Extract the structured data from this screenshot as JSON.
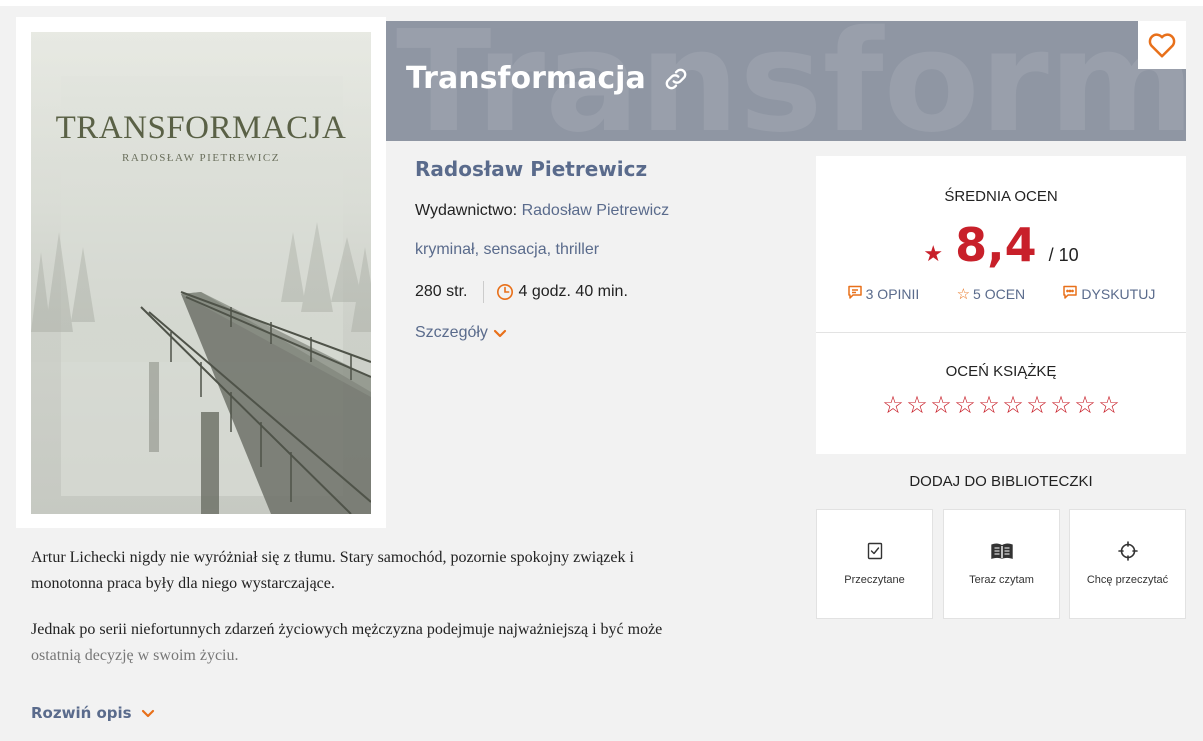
{
  "book": {
    "cover_title": "TRANSFORMACJA",
    "cover_author": "RADOSŁAW PIETREWICZ",
    "watermark": "Transforma",
    "title": "Transformacja",
    "author": "Radosław Pietrewicz",
    "publisher_label": "Wydawnictwo:",
    "publisher": "Radosław Pietrewicz",
    "genres": "kryminał, sensacja, thriller",
    "pages": "280 str.",
    "reading_time": "4 godz. 40 min.",
    "details_link": "Szczegóły"
  },
  "rating": {
    "avg_label": "ŚREDNIA OCEN",
    "avg_value": "8,4",
    "avg_max": "/ 10",
    "opinions": "3 OPINII",
    "ratings": "5 OCEN",
    "discuss": "DYSKUTUJ",
    "rate_label": "OCEŃ KSIĄŻKĘ",
    "stars_total": 10,
    "star_glyph": "☆"
  },
  "library": {
    "label": "DODAJ DO BIBLIOTECZKI",
    "buttons": {
      "read": "Przeczytane",
      "reading": "Teraz czytam",
      "want": "Chcę przeczytać"
    }
  },
  "description": {
    "p1_line1": "Artur Lichecki nigdy nie wyróżniał się z tłumu. Stary samochód, pozornie spokojny związek i",
    "p1_line2": "monotonna praca były dla niego wystarczające.",
    "p2_line1": "Jednak po serii niefortunnych zdarzeń życiowych mężczyzna podejmuje najważniejszą i być może",
    "p2_line2": "ostatnią decyzję w swoim życiu.",
    "expand": "Rozwiń opis"
  },
  "colors": {
    "accent": "#e8701a",
    "rating_red": "#c8202a",
    "link_blue": "#5a6b8c",
    "band": "#8f96a3"
  }
}
